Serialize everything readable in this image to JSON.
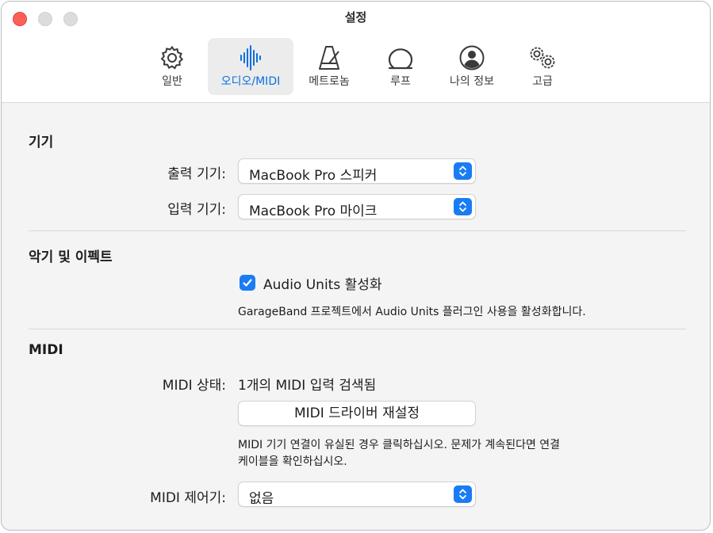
{
  "window": {
    "title": "설정"
  },
  "tabs": [
    {
      "label": "일반",
      "icon": "gear-icon",
      "active": false
    },
    {
      "label": "오디오/MIDI",
      "icon": "waveform-icon",
      "active": true
    },
    {
      "label": "메트로놈",
      "icon": "metronome-icon",
      "active": false
    },
    {
      "label": "루프",
      "icon": "loop-icon",
      "active": false
    },
    {
      "label": "나의 정보",
      "icon": "person-circle-icon",
      "active": false
    },
    {
      "label": "고급",
      "icon": "gears-icon",
      "active": false
    }
  ],
  "devices": {
    "title": "기기",
    "output_label": "출력 기기:",
    "output_value": "MacBook Pro 스피커",
    "input_label": "입력 기기:",
    "input_value": "MacBook Pro 마이크"
  },
  "instruments": {
    "title": "악기 및 이펙트",
    "audio_units_label": "Audio Units 활성화",
    "audio_units_checked": true,
    "audio_units_help": "GarageBand 프로젝트에서 Audio Units 플러그인 사용을 활성화합니다."
  },
  "midi": {
    "title": "MIDI",
    "status_label": "MIDI 상태:",
    "status_value": "1개의 MIDI 입력 검색됨",
    "reset_button": "MIDI 드라이버 재설정",
    "help_line1": "MIDI 기기 연결이 유실된 경우 클릭하십시오. 문제가 계속된다면 연결",
    "help_line2": "케이블을 확인하십시오.",
    "controller_label": "MIDI 제어기:",
    "controller_value": "없음"
  },
  "colors": {
    "accent": "#1a7cf5",
    "close": "#fe5f57",
    "active_tab_text": "#0a6fe0"
  }
}
